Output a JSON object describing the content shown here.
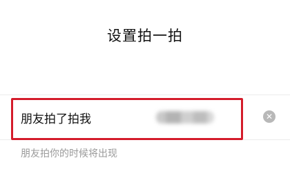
{
  "header": {
    "title": "设置拍一拍"
  },
  "pat_setting": {
    "label": "朋友拍了拍我",
    "clear_icon": "clear-circle-icon",
    "hint": "朋友拍你的时候将出现"
  },
  "colors": {
    "highlight": "#d41b2a",
    "hint_text": "#9a9a9a",
    "clear_icon": "#b8b8b8"
  }
}
